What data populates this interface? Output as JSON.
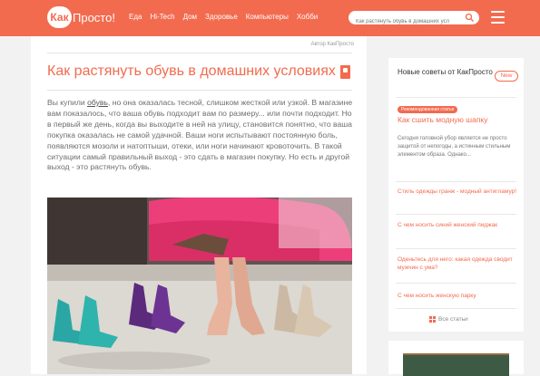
{
  "header": {
    "logo_circle": "Как",
    "logo_rest": "Просто!",
    "nav": [
      "Еда",
      "Hi-Tech",
      "Дом",
      "Здоровье",
      "Компьютеры",
      "Хобби"
    ],
    "search_placeholder": "Как растянуть обувь в домашних усл"
  },
  "article": {
    "author": "Автор КакПросто",
    "title": "Как растянуть обувь в домашних условиях",
    "intro_before_link": "Вы купили ",
    "intro_link": "обувь",
    "intro_after_link": ", но она оказалась тесной, слишком жесткой или узкой. В магазине вам показалось, что ваша обувь подходит вам по размеру... или почти подходит. Но в первый же день, когда вы выходите в ней на улицу, становится понятно, что ваша покупка оказалась не самой удачной. Ваши ноги испытывают постоянную боль, появляются мозоли и натоптыши, отеки, или ноги начинают кровоточить. В такой ситуации самый правильный выход - это сдать в магазин покупку. Но есть и другой выход - это растянуть обувь."
  },
  "sidebar": {
    "title": "Новые советы от КакПросто",
    "new_badge": "New",
    "rec_label": "Рекомендованная статья",
    "featured_link": "Как сшить модную шапку",
    "featured_desc": "Сегодня головной убор является не просто защитой от непогоды, а истинным стильным элементом образа. Однако...",
    "links": [
      "Стиль одежды гранж - модный антигламур!",
      "С чем носить синий женский пиджак",
      "Оденьтесь для него: какая одежда сводит мужчин с ума?",
      "С чем носить женскую парку"
    ],
    "all_label": "Все статьи"
  },
  "colors": {
    "accent": "#f26b4f",
    "page_bg": "#f2f2f2"
  }
}
